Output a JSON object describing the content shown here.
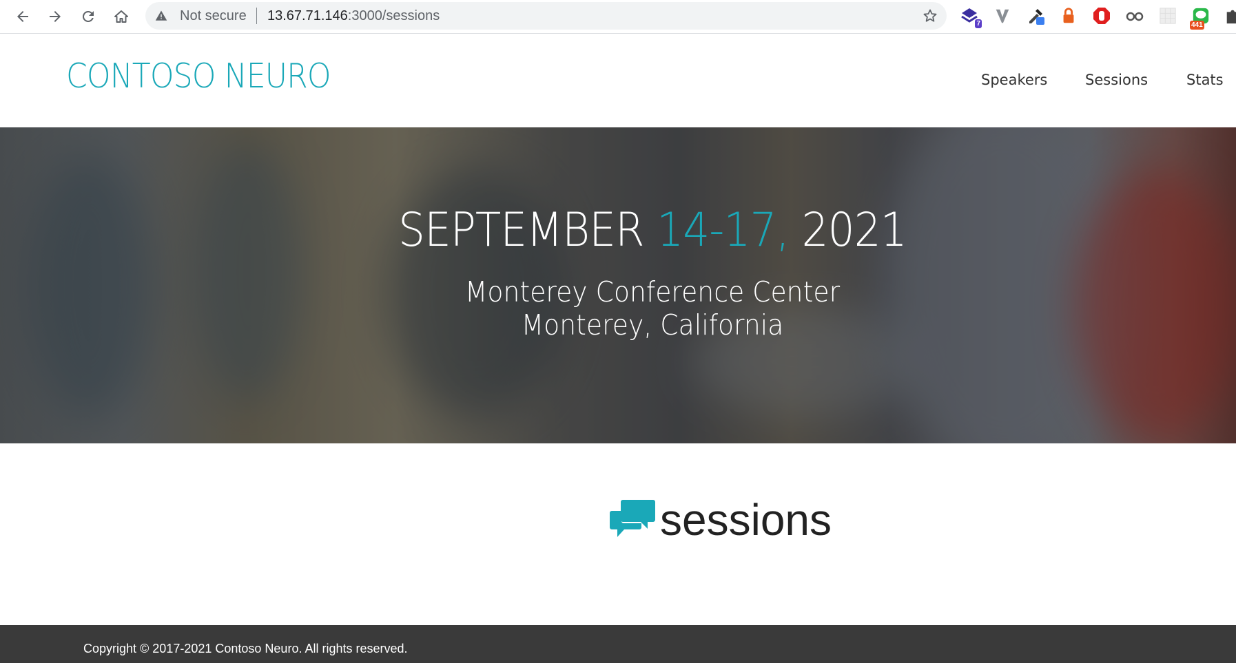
{
  "browser": {
    "security_label": "Not secure",
    "url_host": "13.67.71.146",
    "url_rest": ":3000/sessions",
    "extensions": [
      {
        "icon": "stack-extension-icon",
        "badge": "7",
        "badge_color": "#5b3ec8"
      },
      {
        "icon": "v-extension-icon"
      },
      {
        "icon": "eyedropper-extension-icon"
      },
      {
        "icon": "lock-extension-icon"
      },
      {
        "icon": "stop-hand-extension-icon"
      },
      {
        "icon": "glasses-extension-icon"
      },
      {
        "icon": "grid-extension-icon"
      },
      {
        "icon": "line-extension-icon",
        "badge": "441",
        "badge_color": "#e8501e"
      },
      {
        "icon": "puzzle-extensions-icon"
      }
    ]
  },
  "header": {
    "logo": "CONTOSO NEURO",
    "nav": [
      "Speakers",
      "Sessions",
      "Stats"
    ]
  },
  "hero": {
    "month": "SEPTEMBER",
    "days": "14-17,",
    "year": "2021",
    "venue": "Monterey Conference Center",
    "location": "Monterey, California"
  },
  "main": {
    "icon": "chat-bubbles-icon",
    "title": "sessions"
  },
  "footer": {
    "copyright": "Copyright © 2017-2021 Contoso Neuro. All rights reserved."
  },
  "colors": {
    "brand": "#1aa8b8",
    "footer_bg": "#3a3a3a"
  }
}
